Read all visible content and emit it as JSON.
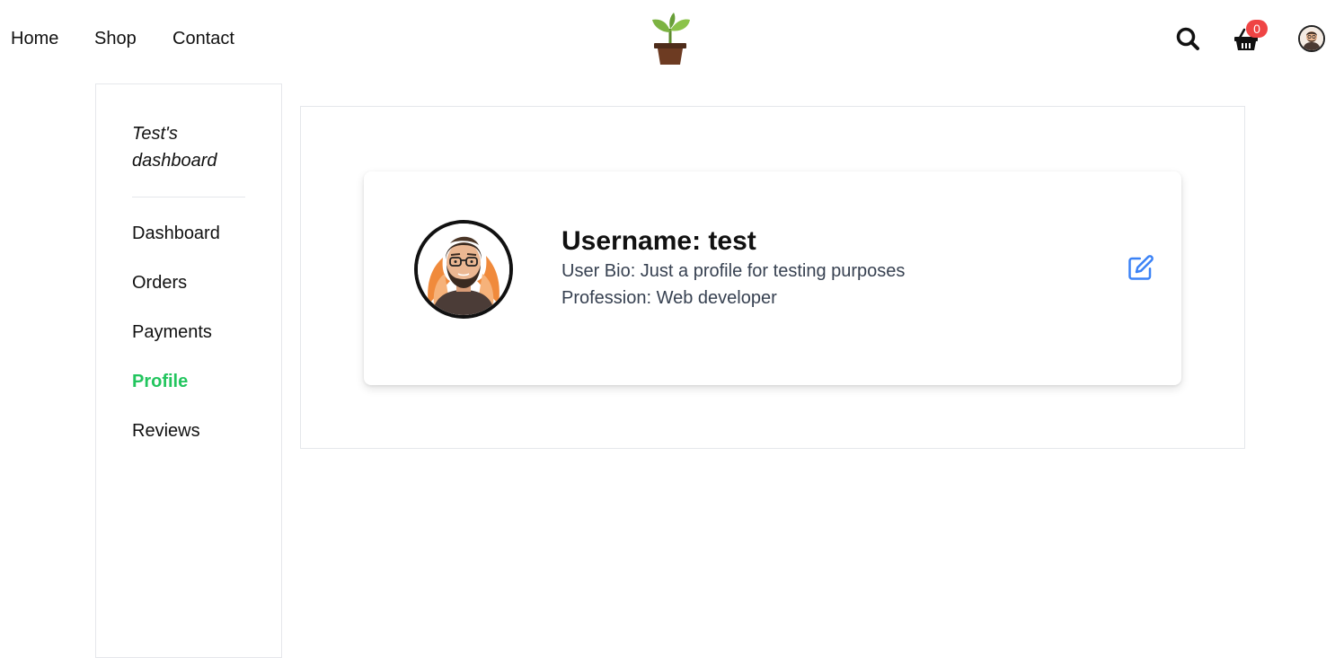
{
  "header": {
    "nav": [
      {
        "label": "Home"
      },
      {
        "label": "Shop"
      },
      {
        "label": "Contact"
      }
    ],
    "logo_icon": "potted-plant-icon",
    "search_icon": "search-icon",
    "cart_icon": "shopping-basket-icon",
    "cart_count": "0",
    "avatar_icon": "user-avatar"
  },
  "sidebar": {
    "title": "Test's dashboard",
    "items": [
      {
        "label": "Dashboard",
        "active": false
      },
      {
        "label": "Orders",
        "active": false
      },
      {
        "label": "Payments",
        "active": false
      },
      {
        "label": "Profile",
        "active": true
      },
      {
        "label": "Reviews",
        "active": false
      }
    ]
  },
  "profile": {
    "username_label": "Username:",
    "username_value": "test",
    "bio": "User Bio: Just a profile for testing purposes",
    "profession": "Profession: Web developer",
    "edit_icon": "edit-icon"
  },
  "colors": {
    "accent_active": "#22c55e",
    "badge": "#ef4444",
    "edit_icon": "#3b82f6"
  }
}
